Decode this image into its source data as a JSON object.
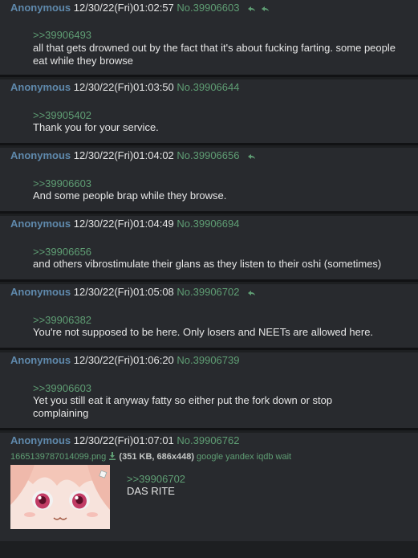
{
  "posts": [
    {
      "name": "Anonymous",
      "date": "12/30/22(Fri)01:02:57",
      "no": "No.39906603",
      "backlinks": 2,
      "quote": ">>39906493",
      "text": "all that gets drowned out by the fact that it's about fucking farting. some people eat while they browse"
    },
    {
      "name": "Anonymous",
      "date": "12/30/22(Fri)01:03:50",
      "no": "No.39906644",
      "backlinks": 0,
      "quote": ">>39905402",
      "text": "Thank you for your service."
    },
    {
      "name": "Anonymous",
      "date": "12/30/22(Fri)01:04:02",
      "no": "No.39906656",
      "backlinks": 1,
      "quote": ">>39906603",
      "text": "And some people brap while they browse."
    },
    {
      "name": "Anonymous",
      "date": "12/30/22(Fri)01:04:49",
      "no": "No.39906694",
      "backlinks": 0,
      "quote": ">>39906656",
      "text": "and others vibrostimulate their glans as they listen to their oshi (sometimes)"
    },
    {
      "name": "Anonymous",
      "date": "12/30/22(Fri)01:05:08",
      "no": "No.39906702",
      "backlinks": 1,
      "quote": ">>39906382",
      "text": "You're not supposed to be here. Only losers and NEETs are allowed here."
    },
    {
      "name": "Anonymous",
      "date": "12/30/22(Fri)01:06:20",
      "no": "No.39906739",
      "backlinks": 0,
      "quote": ">>39906603",
      "text": "Yet you still eat it anyway fatty so either put the fork down or stop complaining"
    },
    {
      "name": "Anonymous",
      "date": "12/30/22(Fri)01:07:01",
      "no": "No.39906762",
      "backlinks": 0,
      "quote": ">>39906702",
      "text": "DAS RITE",
      "file": {
        "name": "1665139787014099.png",
        "meta": "(351 KB, 686x448)",
        "links": "google yandex iqdb wait"
      }
    }
  ],
  "colors": {
    "bg": "#1d1f21",
    "post": "#282a2e",
    "name": "#5f89ac",
    "link": "#5f9e74",
    "text": "#e6e6e6"
  },
  "icons": {
    "backlink": "reply-arrow-icon",
    "download": "download-icon"
  }
}
